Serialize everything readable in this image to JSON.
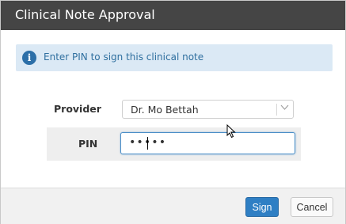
{
  "window": {
    "title": "Clinical Note Approval"
  },
  "info": {
    "icon": "info-icon",
    "text": "Enter PIN to sign this clinical note"
  },
  "form": {
    "provider": {
      "label": "Provider",
      "value": "Dr. Mo Bettah"
    },
    "pin": {
      "label": "PIN",
      "value": "•••••"
    }
  },
  "buttons": {
    "sign": "Sign",
    "cancel": "Cancel"
  },
  "colors": {
    "titlebar": "#454545",
    "info_bg": "#dbe9f5",
    "primary": "#2f7fc4"
  }
}
